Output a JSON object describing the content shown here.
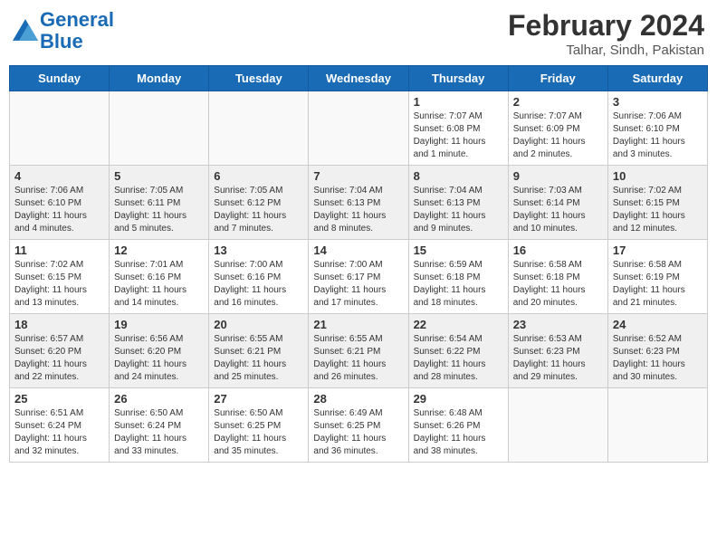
{
  "logo": {
    "line1": "General",
    "line2": "Blue"
  },
  "title": "February 2024",
  "subtitle": "Talhar, Sindh, Pakistan",
  "weekdays": [
    "Sunday",
    "Monday",
    "Tuesday",
    "Wednesday",
    "Thursday",
    "Friday",
    "Saturday"
  ],
  "weeks": [
    [
      {
        "day": "",
        "info": ""
      },
      {
        "day": "",
        "info": ""
      },
      {
        "day": "",
        "info": ""
      },
      {
        "day": "",
        "info": ""
      },
      {
        "day": "1",
        "info": "Sunrise: 7:07 AM\nSunset: 6:08 PM\nDaylight: 11 hours and 1 minute."
      },
      {
        "day": "2",
        "info": "Sunrise: 7:07 AM\nSunset: 6:09 PM\nDaylight: 11 hours and 2 minutes."
      },
      {
        "day": "3",
        "info": "Sunrise: 7:06 AM\nSunset: 6:10 PM\nDaylight: 11 hours and 3 minutes."
      }
    ],
    [
      {
        "day": "4",
        "info": "Sunrise: 7:06 AM\nSunset: 6:10 PM\nDaylight: 11 hours and 4 minutes."
      },
      {
        "day": "5",
        "info": "Sunrise: 7:05 AM\nSunset: 6:11 PM\nDaylight: 11 hours and 5 minutes."
      },
      {
        "day": "6",
        "info": "Sunrise: 7:05 AM\nSunset: 6:12 PM\nDaylight: 11 hours and 7 minutes."
      },
      {
        "day": "7",
        "info": "Sunrise: 7:04 AM\nSunset: 6:13 PM\nDaylight: 11 hours and 8 minutes."
      },
      {
        "day": "8",
        "info": "Sunrise: 7:04 AM\nSunset: 6:13 PM\nDaylight: 11 hours and 9 minutes."
      },
      {
        "day": "9",
        "info": "Sunrise: 7:03 AM\nSunset: 6:14 PM\nDaylight: 11 hours and 10 minutes."
      },
      {
        "day": "10",
        "info": "Sunrise: 7:02 AM\nSunset: 6:15 PM\nDaylight: 11 hours and 12 minutes."
      }
    ],
    [
      {
        "day": "11",
        "info": "Sunrise: 7:02 AM\nSunset: 6:15 PM\nDaylight: 11 hours and 13 minutes."
      },
      {
        "day": "12",
        "info": "Sunrise: 7:01 AM\nSunset: 6:16 PM\nDaylight: 11 hours and 14 minutes."
      },
      {
        "day": "13",
        "info": "Sunrise: 7:00 AM\nSunset: 6:16 PM\nDaylight: 11 hours and 16 minutes."
      },
      {
        "day": "14",
        "info": "Sunrise: 7:00 AM\nSunset: 6:17 PM\nDaylight: 11 hours and 17 minutes."
      },
      {
        "day": "15",
        "info": "Sunrise: 6:59 AM\nSunset: 6:18 PM\nDaylight: 11 hours and 18 minutes."
      },
      {
        "day": "16",
        "info": "Sunrise: 6:58 AM\nSunset: 6:18 PM\nDaylight: 11 hours and 20 minutes."
      },
      {
        "day": "17",
        "info": "Sunrise: 6:58 AM\nSunset: 6:19 PM\nDaylight: 11 hours and 21 minutes."
      }
    ],
    [
      {
        "day": "18",
        "info": "Sunrise: 6:57 AM\nSunset: 6:20 PM\nDaylight: 11 hours and 22 minutes."
      },
      {
        "day": "19",
        "info": "Sunrise: 6:56 AM\nSunset: 6:20 PM\nDaylight: 11 hours and 24 minutes."
      },
      {
        "day": "20",
        "info": "Sunrise: 6:55 AM\nSunset: 6:21 PM\nDaylight: 11 hours and 25 minutes."
      },
      {
        "day": "21",
        "info": "Sunrise: 6:55 AM\nSunset: 6:21 PM\nDaylight: 11 hours and 26 minutes."
      },
      {
        "day": "22",
        "info": "Sunrise: 6:54 AM\nSunset: 6:22 PM\nDaylight: 11 hours and 28 minutes."
      },
      {
        "day": "23",
        "info": "Sunrise: 6:53 AM\nSunset: 6:23 PM\nDaylight: 11 hours and 29 minutes."
      },
      {
        "day": "24",
        "info": "Sunrise: 6:52 AM\nSunset: 6:23 PM\nDaylight: 11 hours and 30 minutes."
      }
    ],
    [
      {
        "day": "25",
        "info": "Sunrise: 6:51 AM\nSunset: 6:24 PM\nDaylight: 11 hours and 32 minutes."
      },
      {
        "day": "26",
        "info": "Sunrise: 6:50 AM\nSunset: 6:24 PM\nDaylight: 11 hours and 33 minutes."
      },
      {
        "day": "27",
        "info": "Sunrise: 6:50 AM\nSunset: 6:25 PM\nDaylight: 11 hours and 35 minutes."
      },
      {
        "day": "28",
        "info": "Sunrise: 6:49 AM\nSunset: 6:25 PM\nDaylight: 11 hours and 36 minutes."
      },
      {
        "day": "29",
        "info": "Sunrise: 6:48 AM\nSunset: 6:26 PM\nDaylight: 11 hours and 38 minutes."
      },
      {
        "day": "",
        "info": ""
      },
      {
        "day": "",
        "info": ""
      }
    ]
  ]
}
